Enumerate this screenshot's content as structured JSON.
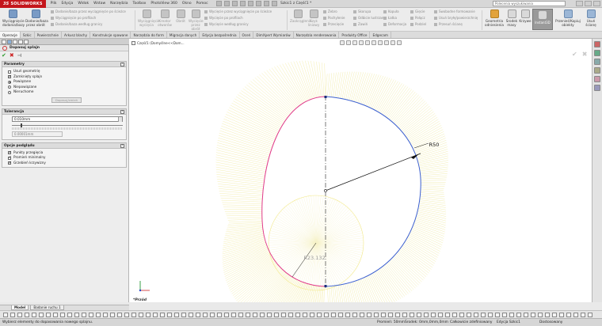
{
  "app": {
    "brand_prefix": "3S",
    "brand_name": "SOLIDWORKS",
    "document_title": "Szkic1 z Część1 *",
    "search_placeholder": "Polecenia wyszukiwania"
  },
  "menu": [
    "Plik",
    "Edycja",
    "Widok",
    "Wstaw",
    "Narzędzia",
    "Toolbox",
    "PhotoView 360",
    "Okno",
    "Pomoc"
  ],
  "ribbon": {
    "extrude_boss": "Wyciągnięcie dodania/bazy",
    "revolve_boss": "Dodanie/baza przez obrót",
    "sweep_boss": "Dodanie/baza przez wyciągnięcie po ścieżce",
    "loft_boss": "Wyciągnięcie po profilach",
    "boundary_boss": "Dodanie/baza według granicy",
    "extruded_cut": "Wyciągnięcie wycięcia",
    "hole_wizard": "Kreator otworów",
    "revolved_cut": "Obrót",
    "cut_by_rotate": "Wycięcie przez obrót",
    "swept_cut": "Wycięcie przez wyciągnięcie po ścieżce",
    "lofted_cut": "Wycięcie po profilach",
    "boundary_cut": "Wycięcie według granicy",
    "fillet": "Zaokrąglenie",
    "linear_pattern": "Szyk liniowy",
    "rib": "Żebro",
    "draft": "Pochylenie",
    "intersect": "Przecięcie",
    "wrap": "Owinięcie",
    "shell": "Skorupa",
    "mirror": "Odbicie lustrzane",
    "wrap2": "Zawiń",
    "dome": "Kopuła",
    "ribs": "Łatka",
    "deform": "Deformacja",
    "bend": "Gięcie",
    "combine": "Połącz",
    "split": "Podziel",
    "free_form": "Swobodne formowanie",
    "delete_body": "Usuń bryłę/powierzchnię",
    "move_face": "Przesuń ścianę",
    "reference_geometry": "Geometria odniesienia",
    "center_of_mass": "Środek masy",
    "curves": "Krzywe",
    "instant3d": "Instant3D",
    "move_copy_bodies": "Przenieś/Kopiuj obiekty",
    "delete_solid": "Usuń ścianę"
  },
  "tabs": [
    "Operacje",
    "Szkic",
    "Powierzchnie",
    "Arkusz blachy",
    "Konstrukcje spawane",
    "Narzędzia do form",
    "Migracja danych",
    "Edycja bezpośrednia",
    "Oceń",
    "DimXpert Wymiarów",
    "Narzędzia renderowania",
    "Produkty Office",
    "Edgecam"
  ],
  "active_tab_index": 0,
  "property_manager": {
    "title": "Dopasuj splajn",
    "params_title": "Parametry",
    "params": [
      {
        "label": "Usuń geometrię",
        "type": "checkbox",
        "checked": false
      },
      {
        "label": "Zamknięty splajn",
        "type": "checkbox",
        "checked": true
      },
      {
        "label": "Powiązane",
        "type": "radio",
        "checked": true
      },
      {
        "label": "Niepowiązane",
        "type": "radio",
        "checked": false
      },
      {
        "label": "Nieruchome",
        "type": "radio",
        "checked": false
      }
    ],
    "adjust_button": "Dopasuj/zmień",
    "tolerance_title": "Tolerancja",
    "tolerance_value": "0.010mm",
    "tolerance_slider": 0.08,
    "tolerance_output": "0.00001mm",
    "options_title": "Opcje podglądu",
    "options": [
      {
        "label": "Punkty przegięcia",
        "checked": true
      },
      {
        "label": "Promień minimalny",
        "checked": true
      },
      {
        "label": "Grzebień krzywizny",
        "checked": true
      }
    ]
  },
  "graphics": {
    "tree_crumb": "Część1 (Domyślne<<Dom...",
    "dimension_ellipse": "R50",
    "dimension_circle": "R23.132",
    "view_label": "*Przód"
  },
  "bottom_tabs": [
    "Model",
    "Badanie ruchu 1"
  ],
  "status": {
    "message": "Wybierz elementy do dopasowania nowego splajnu.",
    "radius": "Promień: 50mm",
    "center": "Środek: 0mm,0mm,0mm",
    "definition": "Całkowicie zdefiniowany",
    "editing": "Edycja Szkic1",
    "custom": "Dostosowany"
  }
}
